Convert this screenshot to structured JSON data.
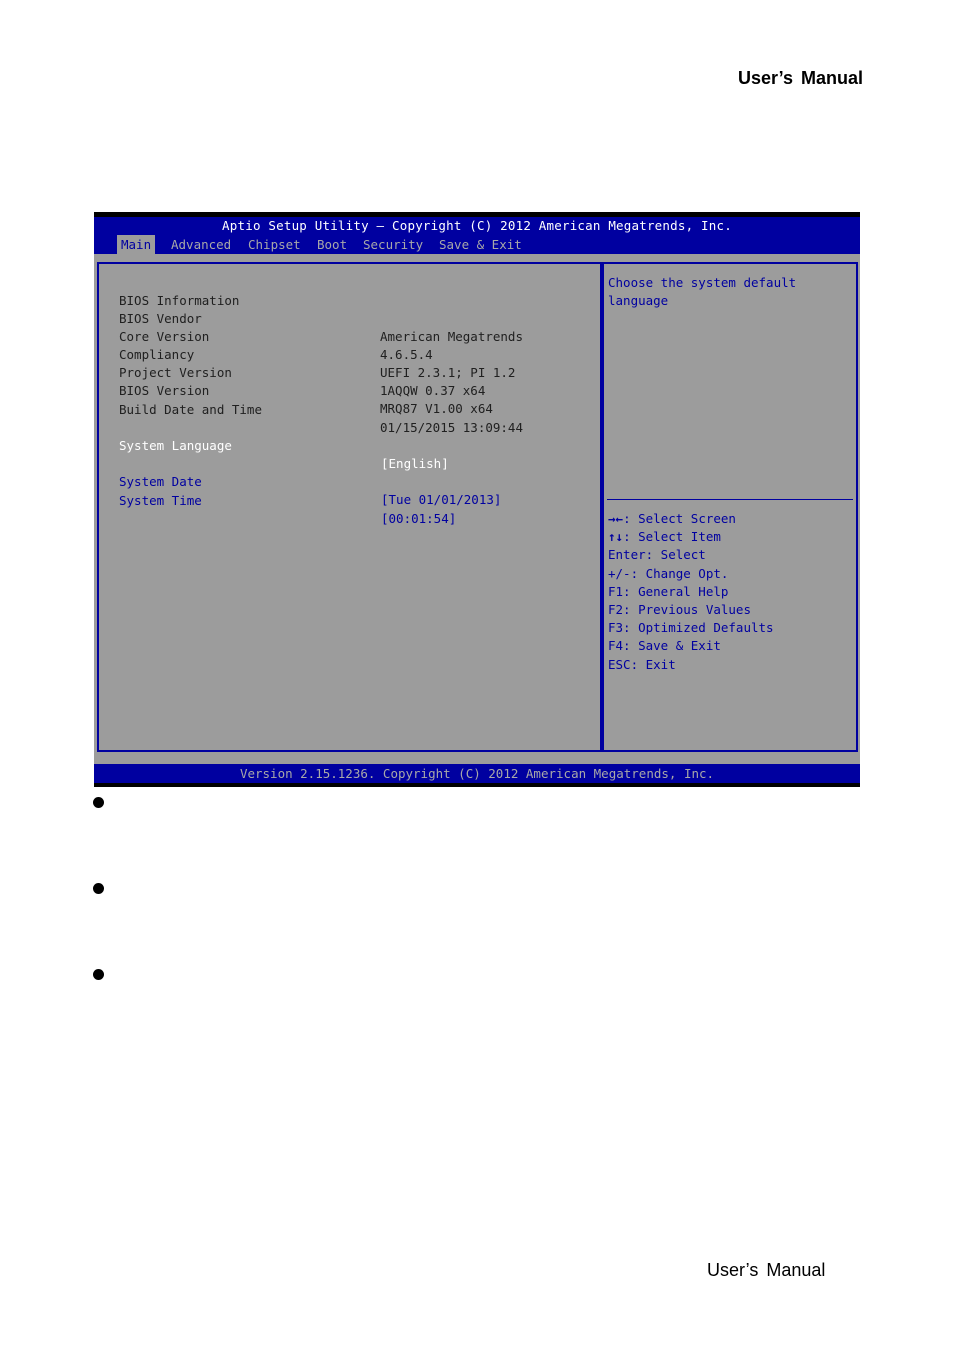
{
  "page": {
    "header_title": "User’s  Manual",
    "footer_title": "User’s  Manual",
    "bullets": 3
  },
  "bios": {
    "title": "Aptio Setup Utility – Copyright (C) 2012 American Megatrends, Inc.",
    "tabs": [
      {
        "label": "Main",
        "active": true
      },
      {
        "label": "Advanced",
        "active": false
      },
      {
        "label": "Chipset",
        "active": false
      },
      {
        "label": "Boot",
        "active": false
      },
      {
        "label": "Security",
        "active": false
      },
      {
        "label": "Save & Exit",
        "active": false
      }
    ],
    "info_heading": "BIOS Information",
    "info_rows": [
      {
        "label": "BIOS Vendor",
        "value": "American Megatrends"
      },
      {
        "label": "Core Version",
        "value": "4.6.5.4"
      },
      {
        "label": "Compliancy",
        "value": "UEFI 2.3.1; PI 1.2"
      },
      {
        "label": "Project Version",
        "value": "1AQQW 0.37 x64"
      },
      {
        "label": "BIOS Version",
        "value": "MRQ87 V1.00 x64"
      },
      {
        "label": "Build Date and Time",
        "value": "01/15/2015 13:09:44"
      }
    ],
    "settings": {
      "language": {
        "label": "System Language",
        "value": "[English]"
      },
      "date": {
        "label": "System Date",
        "value": "[Tue 01/01/2013]"
      },
      "time": {
        "label": "System Time",
        "value": "[00:01:54]"
      }
    },
    "help_text": "Choose the system default language",
    "key_help": [
      {
        "key": "→←",
        "desc": ": Select Screen"
      },
      {
        "key": "↑↓",
        "desc": ": Select Item"
      },
      {
        "key": "",
        "desc": "Enter: Select"
      },
      {
        "key": "",
        "desc": "+/-: Change Opt."
      },
      {
        "key": "",
        "desc": "F1: General Help"
      },
      {
        "key": "",
        "desc": "F2: Previous Values"
      },
      {
        "key": "",
        "desc": "F3: Optimized Defaults"
      },
      {
        "key": "",
        "desc": "F4: Save & Exit"
      },
      {
        "key": "",
        "desc": "ESC: Exit"
      }
    ],
    "footer": "Version 2.15.1236. Copyright (C) 2012 American Megatrends, Inc.",
    "colors": {
      "blue": "#0000a0",
      "gray_bg": "#9c9c9c",
      "inactive_text": "#a8a8a8"
    }
  }
}
